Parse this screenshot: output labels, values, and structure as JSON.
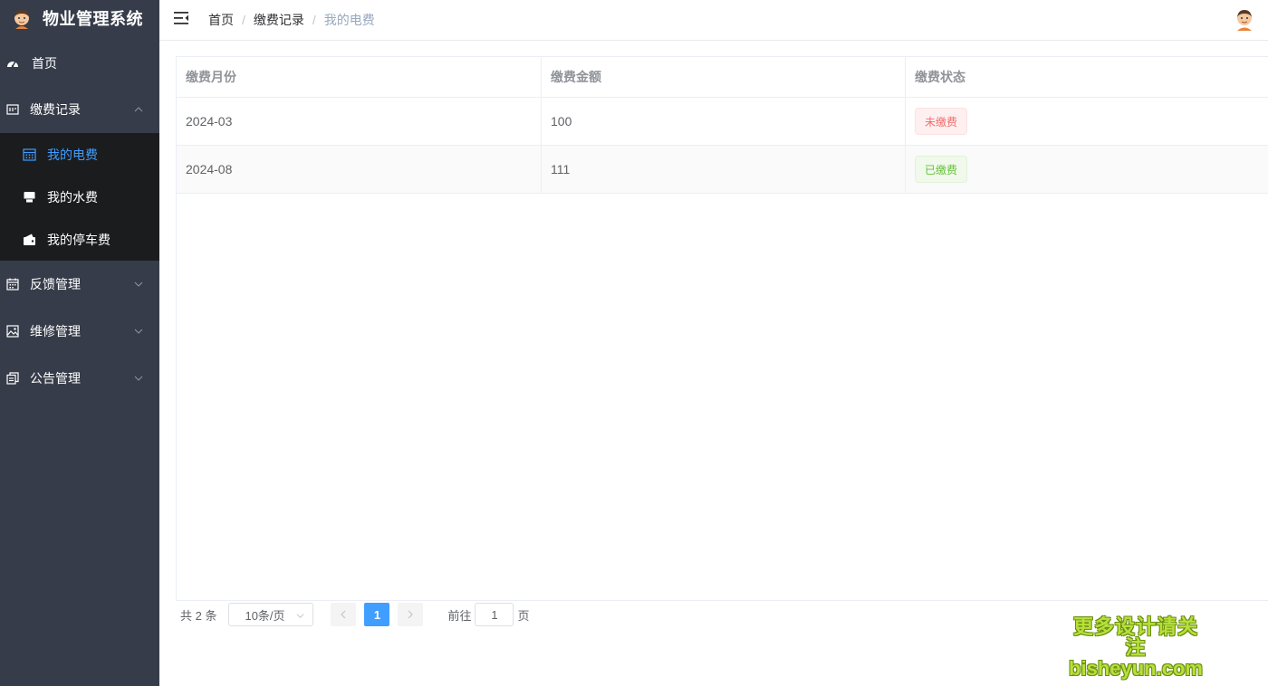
{
  "app": {
    "title": "物业管理系统"
  },
  "sidebar": {
    "home": {
      "label": "首页",
      "icon": "dashboard-icon"
    },
    "groups": [
      {
        "label": "缴费记录",
        "icon": "receipt-icon",
        "expanded": true,
        "items": [
          {
            "label": "我的电费",
            "icon": "calendar-icon",
            "active": true
          },
          {
            "label": "我的水费",
            "icon": "printer-icon",
            "active": false
          },
          {
            "label": "我的停车费",
            "icon": "wallet-icon",
            "active": false
          }
        ]
      },
      {
        "label": "反馈管理",
        "icon": "date-icon",
        "expanded": false
      },
      {
        "label": "维修管理",
        "icon": "picture-icon",
        "expanded": false
      },
      {
        "label": "公告管理",
        "icon": "copy-icon",
        "expanded": false
      }
    ]
  },
  "header": {
    "breadcrumb": [
      "首页",
      "缴费记录",
      "我的电费"
    ],
    "separator": "/"
  },
  "table": {
    "columns": [
      "缴费月份",
      "缴费金额",
      "缴费状态"
    ],
    "rows": [
      {
        "month": "2024-03",
        "amount": "100",
        "status": "未缴费",
        "status_type": "danger"
      },
      {
        "month": "2024-08",
        "amount": "111",
        "status": "已缴费",
        "status_type": "success"
      }
    ]
  },
  "pagination": {
    "total_text": "共 2 条",
    "page_size": "10条/页",
    "current_page": "1",
    "jump_prefix": "前往",
    "jump_value": "1",
    "jump_suffix": "页"
  },
  "watermark": {
    "line1": "更多设计请关注",
    "line2": "bisheyun.com"
  },
  "colors": {
    "sidebar_bg": "#363c49",
    "submenu_bg": "#1b1c1e",
    "accent": "#409eff"
  }
}
